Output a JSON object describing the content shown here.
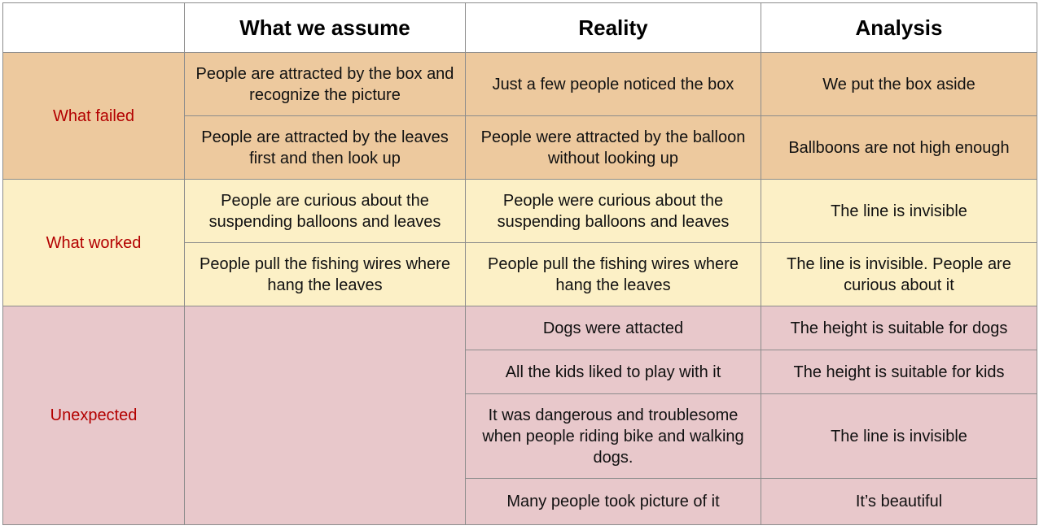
{
  "header": {
    "col1": "",
    "col2": "What we assume",
    "col3": "Reality",
    "col4": "Analysis"
  },
  "colors": {
    "failed_bg": "#edc99e",
    "worked_bg": "#fcf0c6",
    "unexpected_bg": "#e8c8cb",
    "label_text": "#b30000",
    "border": "#8c8c8c"
  },
  "groups": {
    "failed": {
      "label": "What failed",
      "rows": [
        {
          "assume": "People are attracted by the  box and recognize the picture",
          "reality": "Just a few people noticed the box",
          "analysis": "We put the box aside"
        },
        {
          "assume": "People are attracted by the leaves first and then look up",
          "reality": "People were attracted by the balloon without looking up",
          "analysis": "Ballboons are not high enough"
        }
      ]
    },
    "worked": {
      "label": "What worked",
      "rows": [
        {
          "assume": "People are curious about the suspending balloons and leaves",
          "reality": "People were curious about the suspending balloons and leaves",
          "analysis": "The line is invisible"
        },
        {
          "assume": "People pull the fishing wires where hang the leaves",
          "reality": "People pull the fishing wires where hang the leaves",
          "analysis": "The line is invisible. People are curious about it"
        }
      ]
    },
    "unexpected": {
      "label": "Unexpected",
      "assume": "",
      "rows": [
        {
          "reality": "Dogs were attacted",
          "analysis": "The height  is suitable for dogs"
        },
        {
          "reality": "All the kids liked to play with it",
          "analysis": "The height  is suitable for kids"
        },
        {
          "reality": "It was dangerous and troublesome when people riding bike and walking dogs.",
          "analysis": "The line is invisible"
        },
        {
          "reality": "Many people took picture of it",
          "analysis": "It’s beautiful"
        }
      ]
    }
  }
}
